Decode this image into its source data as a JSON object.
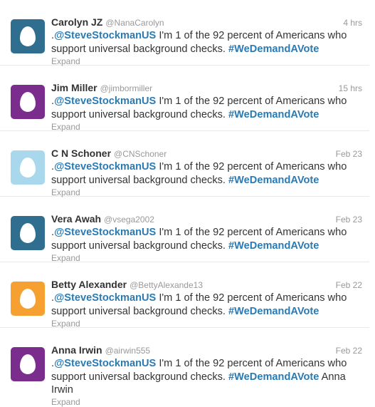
{
  "tweets": [
    {
      "fullname": "Carolyn JZ",
      "username": "@NanaCarolyn",
      "time": "4 hrs",
      "avatar_color": "#2f6e8f",
      "prefix": ".",
      "mention": "@SteveStockmanUS",
      "body": " I'm 1 of the 92 percent of Americans who support universal background checks. ",
      "hashtag": "#WeDemandAVote",
      "suffix": "",
      "expand": "Expand"
    },
    {
      "fullname": "Jim Miller",
      "username": "@jimbormiller",
      "time": "15 hrs",
      "avatar_color": "#7b2d8e",
      "prefix": ".",
      "mention": "@SteveStockmanUS",
      "body": " I'm 1 of the 92 percent of Americans who support universal background checks. ",
      "hashtag": "#WeDemandAVote",
      "suffix": "",
      "expand": "Expand"
    },
    {
      "fullname": "C N Schoner",
      "username": "@CNSchoner",
      "time": "Feb 23",
      "avatar_color": "#a9d8ec",
      "prefix": ".",
      "mention": "@SteveStockmanUS",
      "body": " I'm 1 of the 92 percent of Americans who support universal background checks. ",
      "hashtag": "#WeDemandAVote",
      "suffix": "",
      "expand": "Expand"
    },
    {
      "fullname": "Vera Awah",
      "username": "@vsega2002",
      "time": "Feb 23",
      "avatar_color": "#2f6e8f",
      "prefix": ".",
      "mention": "@SteveStockmanUS",
      "body": " I'm 1 of the 92 percent of Americans who support universal background checks. ",
      "hashtag": "#WeDemandAVote",
      "suffix": "",
      "expand": "Expand"
    },
    {
      "fullname": "Betty Alexander",
      "username": "@BettyAlexande13",
      "time": "Feb 22",
      "avatar_color": "#f5a030",
      "prefix": ".",
      "mention": "@SteveStockmanUS",
      "body": " I'm 1 of the 92 percent of Americans who support universal background checks. ",
      "hashtag": "#WeDemandAVote",
      "suffix": "",
      "expand": "Expand"
    },
    {
      "fullname": "Anna Irwin",
      "username": "@airwin555",
      "time": "Feb 22",
      "avatar_color": "#7b2d8e",
      "prefix": ".",
      "mention": "@SteveStockmanUS",
      "body": " I'm 1 of the 92 percent of Americans who support universal background checks. ",
      "hashtag": "#WeDemandAVote",
      "suffix": " Anna Irwin",
      "expand": "Expand"
    }
  ]
}
